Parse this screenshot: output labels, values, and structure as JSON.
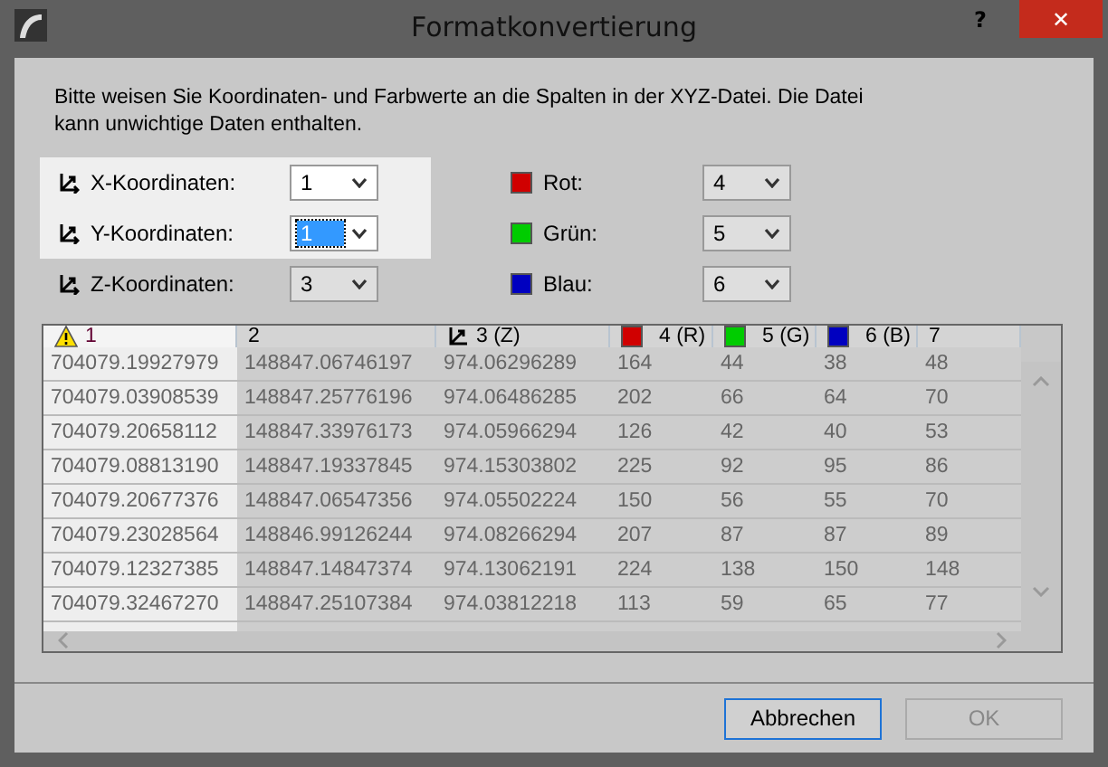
{
  "window": {
    "title": "Formatkonvertierung",
    "help": "?",
    "close": "✕"
  },
  "instructions": "Bitte weisen Sie Koordinaten- und Farbwerte an die Spalten in der XYZ-Datei. Die Datei kann unwichtige Daten enthalten.",
  "coordinates": [
    {
      "label": "X-Koordinaten:",
      "value": "1",
      "highlighted": true,
      "focused": false
    },
    {
      "label": "Y-Koordinaten:",
      "value": "1",
      "highlighted": true,
      "focused": true
    },
    {
      "label": "Z-Koordinaten:",
      "value": "3",
      "highlighted": false,
      "focused": false
    }
  ],
  "colors": [
    {
      "label": "Rot:",
      "color": "#d00000",
      "value": "4"
    },
    {
      "label": "Grün:",
      "color": "#00cc00",
      "value": "5"
    },
    {
      "label": "Blau:",
      "color": "#0000c0",
      "value": "6"
    }
  ],
  "table": {
    "columns": [
      {
        "label": "1",
        "kind": "warning",
        "highlighted": true
      },
      {
        "label": "2",
        "kind": "plain",
        "highlighted": false
      },
      {
        "label": "3 (Z)",
        "kind": "axis",
        "highlighted": false
      },
      {
        "label": "4 (R)",
        "kind": "color",
        "color": "#d00000",
        "highlighted": false
      },
      {
        "label": "5 (G)",
        "kind": "color",
        "color": "#00cc00",
        "highlighted": false
      },
      {
        "label": "6 (B)",
        "kind": "color",
        "color": "#0000c0",
        "highlighted": false
      },
      {
        "label": "7",
        "kind": "plain",
        "highlighted": false
      }
    ],
    "rows": [
      [
        "704079.19927979",
        "148847.06746197",
        "974.06296289",
        "164",
        "44",
        "38",
        "48"
      ],
      [
        "704079.03908539",
        "148847.25776196",
        "974.06486285",
        "202",
        "66",
        "64",
        "70"
      ],
      [
        "704079.20658112",
        "148847.33976173",
        "974.05966294",
        "126",
        "42",
        "40",
        "53"
      ],
      [
        "704079.08813190",
        "148847.19337845",
        "974.15303802",
        "225",
        "92",
        "95",
        "86"
      ],
      [
        "704079.20677376",
        "148847.06547356",
        "974.05502224",
        "150",
        "56",
        "55",
        "70"
      ],
      [
        "704079.23028564",
        "148846.99126244",
        "974.08266294",
        "207",
        "87",
        "87",
        "89"
      ],
      [
        "704079.12327385",
        "148847.14847374",
        "974.13062191",
        "224",
        "138",
        "150",
        "148"
      ],
      [
        "704079.32467270",
        "148847.25107384",
        "974.03812218",
        "113",
        "59",
        "65",
        "77"
      ]
    ]
  },
  "buttons": [
    {
      "label": "Abbrechen",
      "disabled": false,
      "default": true
    },
    {
      "label": "OK",
      "disabled": true,
      "default": false
    }
  ]
}
